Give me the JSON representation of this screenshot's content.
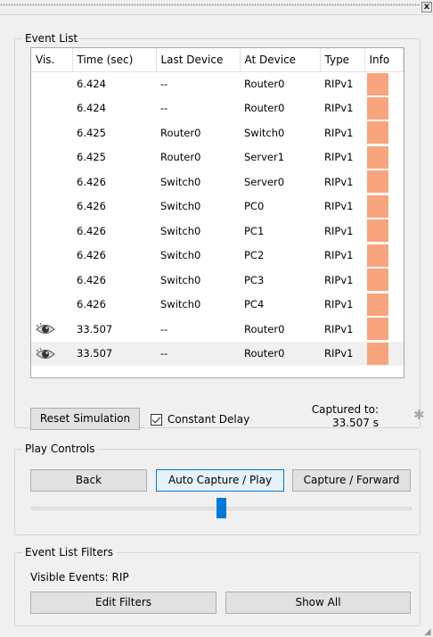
{
  "window": {
    "close_label": "x"
  },
  "event_list": {
    "legend": "Event List",
    "columns": [
      "Vis.",
      "Time (sec)",
      "Last Device",
      "At Device",
      "Type",
      "Info"
    ],
    "rows": [
      {
        "vis": "",
        "time": "6.424",
        "last": "--",
        "at": "Router0",
        "type": "RIPv1",
        "info_color": "#f8a47c"
      },
      {
        "vis": "",
        "time": "6.424",
        "last": "--",
        "at": "Router0",
        "type": "RIPv1",
        "info_color": "#f8a47c"
      },
      {
        "vis": "",
        "time": "6.425",
        "last": "Router0",
        "at": "Switch0",
        "type": "RIPv1",
        "info_color": "#f8a47c"
      },
      {
        "vis": "",
        "time": "6.425",
        "last": "Router0",
        "at": "Server1",
        "type": "RIPv1",
        "info_color": "#f8a47c"
      },
      {
        "vis": "",
        "time": "6.426",
        "last": "Switch0",
        "at": "Server0",
        "type": "RIPv1",
        "info_color": "#f8a47c"
      },
      {
        "vis": "",
        "time": "6.426",
        "last": "Switch0",
        "at": "PC0",
        "type": "RIPv1",
        "info_color": "#f8a47c"
      },
      {
        "vis": "",
        "time": "6.426",
        "last": "Switch0",
        "at": "PC1",
        "type": "RIPv1",
        "info_color": "#f8a47c"
      },
      {
        "vis": "",
        "time": "6.426",
        "last": "Switch0",
        "at": "PC2",
        "type": "RIPv1",
        "info_color": "#f8a47c"
      },
      {
        "vis": "",
        "time": "6.426",
        "last": "Switch0",
        "at": "PC3",
        "type": "RIPv1",
        "info_color": "#f8a47c"
      },
      {
        "vis": "",
        "time": "6.426",
        "last": "Switch0",
        "at": "PC4",
        "type": "RIPv1",
        "info_color": "#f8a47c"
      },
      {
        "vis": "eye-icon",
        "time": "33.507",
        "last": "--",
        "at": "Router0",
        "type": "RIPv1",
        "info_color": "#f8a47c"
      },
      {
        "vis": "eye-icon",
        "time": "33.507",
        "last": "--",
        "at": "Router0",
        "type": "RIPv1",
        "info_color": "#f8a47c",
        "selected": true
      }
    ],
    "reset_label": "Reset Simulation",
    "constant_delay_label": "Constant Delay",
    "constant_delay_checked": true,
    "captured_label": "Captured to:",
    "captured_value": "33.507 s"
  },
  "play_controls": {
    "legend": "Play Controls",
    "back_label": "Back",
    "auto_label": "Auto Capture / Play",
    "forward_label": "Capture / Forward",
    "speed_fraction": 0.5
  },
  "filters": {
    "legend": "Event List Filters",
    "visible_label": "Visible Events:",
    "visible_value": "RIP",
    "edit_label": "Edit Filters",
    "show_all_label": "Show All"
  },
  "colors": {
    "info": "#f8a47c",
    "accent": "#0078d7"
  }
}
